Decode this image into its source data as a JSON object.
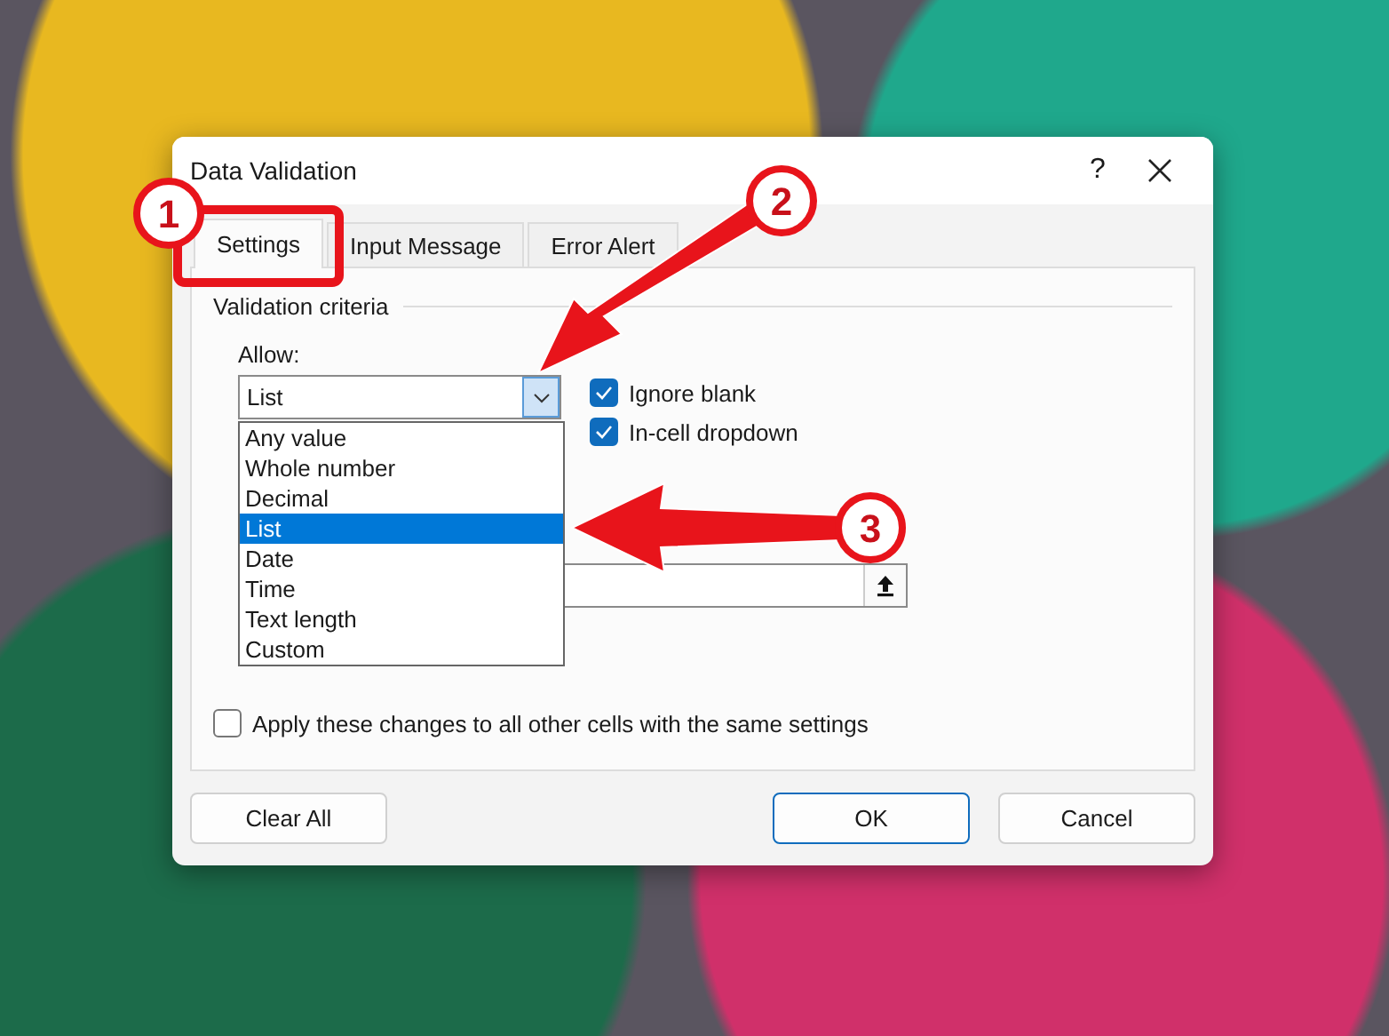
{
  "dialog": {
    "title": "Data Validation",
    "help": "?"
  },
  "tabs": [
    {
      "label": "Settings",
      "selected": true
    },
    {
      "label": "Input Message",
      "selected": false
    },
    {
      "label": "Error Alert",
      "selected": false
    }
  ],
  "group": {
    "title": "Validation criteria",
    "allow_label": "Allow:",
    "allow_value": "List"
  },
  "checkboxes": [
    {
      "label": "Ignore blank",
      "checked": true
    },
    {
      "label": "In-cell dropdown",
      "checked": true
    }
  ],
  "dropdown": {
    "options": [
      {
        "label": "Any value",
        "selected": false
      },
      {
        "label": "Whole number",
        "selected": false
      },
      {
        "label": "Decimal",
        "selected": false
      },
      {
        "label": "List",
        "selected": true
      },
      {
        "label": "Date",
        "selected": false
      },
      {
        "label": "Time",
        "selected": false
      },
      {
        "label": "Text length",
        "selected": false
      },
      {
        "label": "Custom",
        "selected": false
      }
    ]
  },
  "apply": {
    "label": "Apply these changes to all other cells with the same settings",
    "checked": false
  },
  "buttons": [
    {
      "label": "Clear All",
      "kind": "plain"
    },
    {
      "label": "OK",
      "kind": "default"
    },
    {
      "label": "Cancel",
      "kind": "plain"
    }
  ],
  "callouts": [
    {
      "number": "1"
    },
    {
      "number": "2"
    },
    {
      "number": "3"
    }
  ]
}
